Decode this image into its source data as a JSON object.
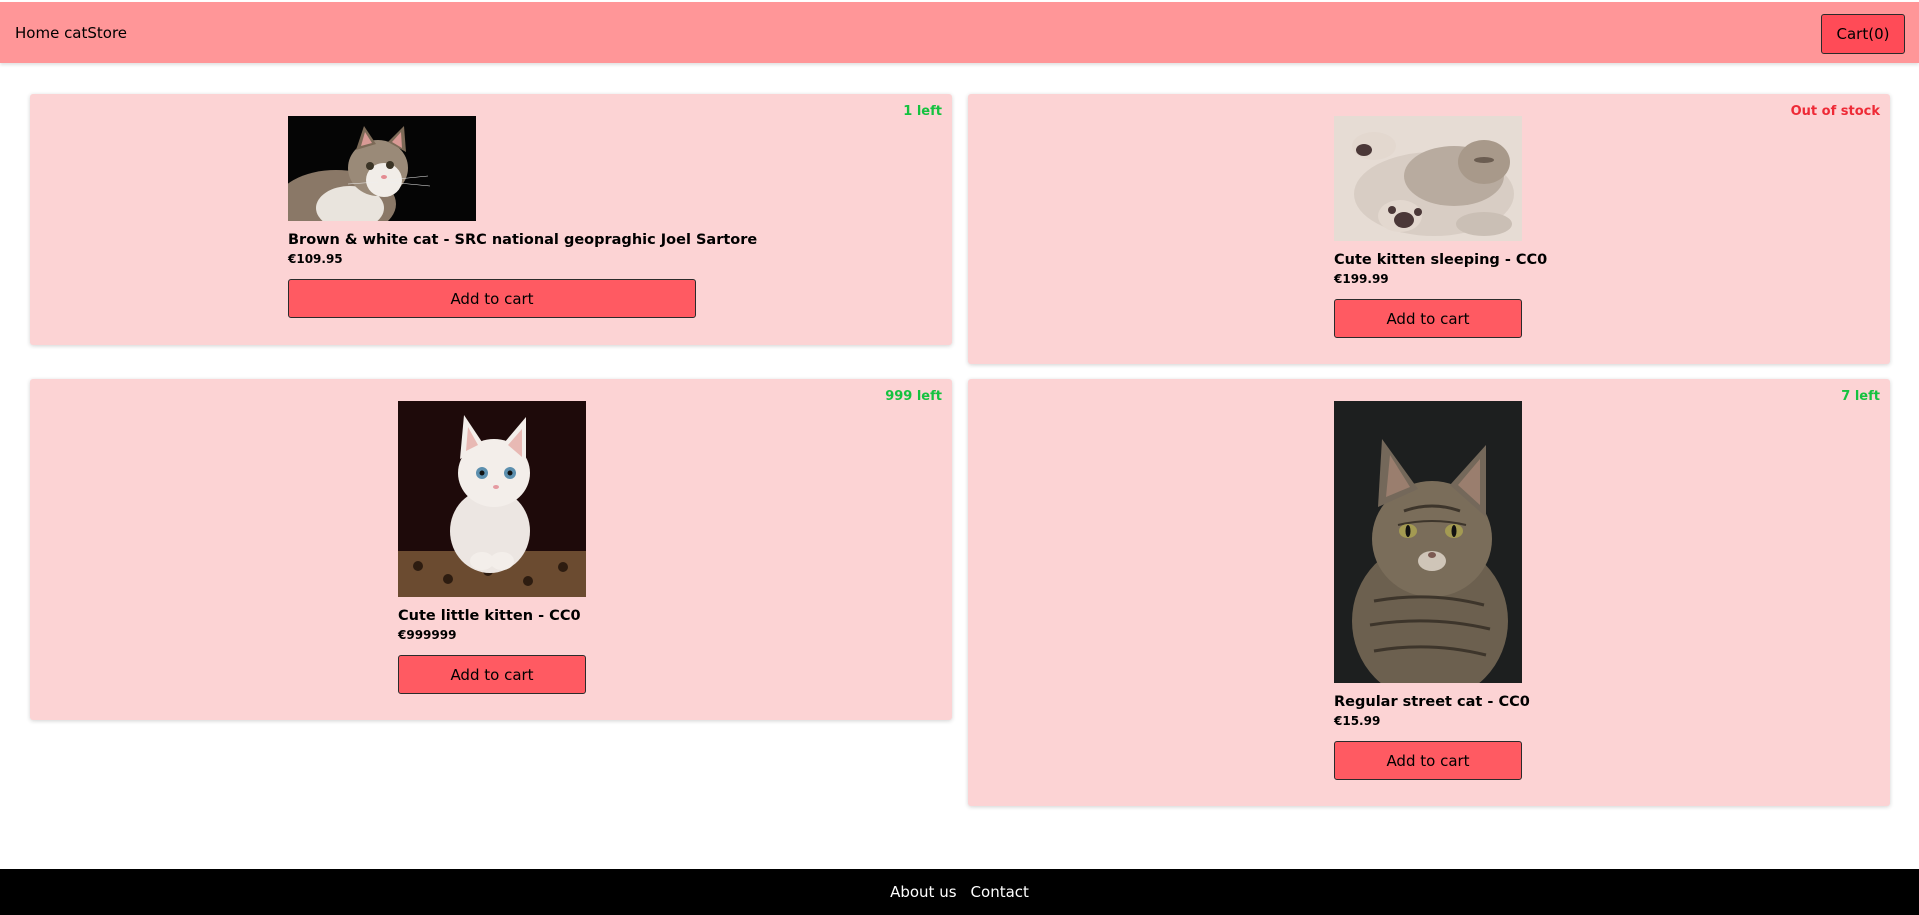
{
  "nav": {
    "brand": "Home catStore",
    "cart_label": "Cart(0)"
  },
  "products": [
    {
      "name": "Brown & white cat - SRC national geopraghic Joel Sartore",
      "price": "€109.95",
      "stock": "1 left",
      "button": "Add to cart"
    },
    {
      "name": "Cute kitten sleeping - CC0",
      "price": "€199.99",
      "stock": "Out of stock",
      "button": "Add to cart"
    },
    {
      "name": "Cute little kitten - CC0",
      "price": "€999999",
      "stock": "999 left",
      "button": "Add to cart"
    },
    {
      "name": "Regular street cat - CC0",
      "price": "€15.99",
      "stock": "7 left",
      "button": "Add to cart"
    }
  ],
  "footer": {
    "about": "About us",
    "contact": "Contact"
  },
  "colors": {
    "navbar": "#ff9698",
    "card": "#fcd3d4",
    "button": "#ff5a62",
    "in_stock": "#14c23f",
    "out_of_stock": "#ee2a36"
  }
}
